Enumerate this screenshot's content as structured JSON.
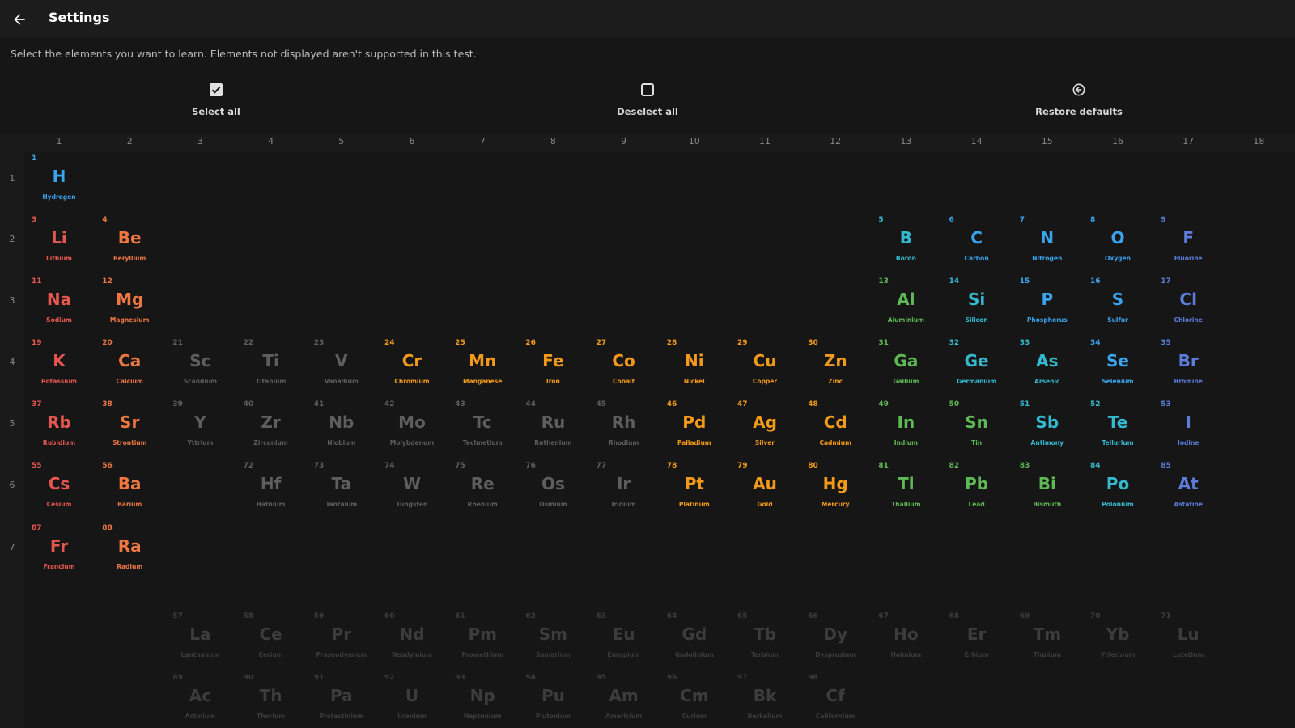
{
  "header": {
    "title": "Settings"
  },
  "description": "Select the elements you want to learn. Elements not displayed aren't supported in this test.",
  "actions": [
    {
      "label": "Select all",
      "icon": "checkbox-checked-icon"
    },
    {
      "label": "Deselect all",
      "icon": "checkbox-empty-icon"
    },
    {
      "label": "Restore defaults",
      "icon": "restore-icon"
    }
  ],
  "groups": [
    "1",
    "2",
    "3",
    "4",
    "5",
    "6",
    "7",
    "8",
    "9",
    "10",
    "11",
    "12",
    "13",
    "14",
    "15",
    "16",
    "17",
    "18"
  ],
  "periods": [
    "1",
    "2",
    "3",
    "4",
    "5",
    "6",
    "7"
  ],
  "colors": {
    "alkali": "#e8574f",
    "alkaline": "#ee7742",
    "transition": "#f39a1c",
    "post": "#5fb954",
    "metalloid": "#35b9cf",
    "nonmetal": "#3aa4ee",
    "halogen": "#5c7ddb",
    "unselected": "#5e5e5e",
    "lan": "#3c3c3c"
  },
  "elements": [
    {
      "n": "1",
      "s": "H",
      "name": "Hydrogen",
      "r": 1,
      "c": 1,
      "cat": "nonmetal"
    },
    {
      "n": "3",
      "s": "Li",
      "name": "Lithium",
      "r": 2,
      "c": 1,
      "cat": "alkali"
    },
    {
      "n": "4",
      "s": "Be",
      "name": "Beryllium",
      "r": 2,
      "c": 2,
      "cat": "alkaline"
    },
    {
      "n": "5",
      "s": "B",
      "name": "Boron",
      "r": 2,
      "c": 13,
      "cat": "metalloid"
    },
    {
      "n": "6",
      "s": "C",
      "name": "Carbon",
      "r": 2,
      "c": 14,
      "cat": "nonmetal"
    },
    {
      "n": "7",
      "s": "N",
      "name": "Nitrogen",
      "r": 2,
      "c": 15,
      "cat": "nonmetal"
    },
    {
      "n": "8",
      "s": "O",
      "name": "Oxygen",
      "r": 2,
      "c": 16,
      "cat": "nonmetal"
    },
    {
      "n": "9",
      "s": "F",
      "name": "Fluorine",
      "r": 2,
      "c": 17,
      "cat": "halogen"
    },
    {
      "n": "11",
      "s": "Na",
      "name": "Sodium",
      "r": 3,
      "c": 1,
      "cat": "alkali"
    },
    {
      "n": "12",
      "s": "Mg",
      "name": "Magnesium",
      "r": 3,
      "c": 2,
      "cat": "alkaline"
    },
    {
      "n": "13",
      "s": "Al",
      "name": "Aluminium",
      "r": 3,
      "c": 13,
      "cat": "post"
    },
    {
      "n": "14",
      "s": "Si",
      "name": "Silicon",
      "r": 3,
      "c": 14,
      "cat": "metalloid"
    },
    {
      "n": "15",
      "s": "P",
      "name": "Phosphorus",
      "r": 3,
      "c": 15,
      "cat": "nonmetal"
    },
    {
      "n": "16",
      "s": "S",
      "name": "Sulfur",
      "r": 3,
      "c": 16,
      "cat": "nonmetal"
    },
    {
      "n": "17",
      "s": "Cl",
      "name": "Chlorine",
      "r": 3,
      "c": 17,
      "cat": "halogen"
    },
    {
      "n": "19",
      "s": "K",
      "name": "Potassium",
      "r": 4,
      "c": 1,
      "cat": "alkali"
    },
    {
      "n": "20",
      "s": "Ca",
      "name": "Calcium",
      "r": 4,
      "c": 2,
      "cat": "alkaline"
    },
    {
      "n": "21",
      "s": "Sc",
      "name": "Scandium",
      "r": 4,
      "c": 3,
      "cat": "unselected"
    },
    {
      "n": "22",
      "s": "Ti",
      "name": "Titanium",
      "r": 4,
      "c": 4,
      "cat": "unselected"
    },
    {
      "n": "23",
      "s": "V",
      "name": "Vanadium",
      "r": 4,
      "c": 5,
      "cat": "unselected"
    },
    {
      "n": "24",
      "s": "Cr",
      "name": "Chromium",
      "r": 4,
      "c": 6,
      "cat": "transition"
    },
    {
      "n": "25",
      "s": "Mn",
      "name": "Manganese",
      "r": 4,
      "c": 7,
      "cat": "transition"
    },
    {
      "n": "26",
      "s": "Fe",
      "name": "Iron",
      "r": 4,
      "c": 8,
      "cat": "transition"
    },
    {
      "n": "27",
      "s": "Co",
      "name": "Cobalt",
      "r": 4,
      "c": 9,
      "cat": "transition"
    },
    {
      "n": "28",
      "s": "Ni",
      "name": "Nickel",
      "r": 4,
      "c": 10,
      "cat": "transition"
    },
    {
      "n": "29",
      "s": "Cu",
      "name": "Copper",
      "r": 4,
      "c": 11,
      "cat": "transition"
    },
    {
      "n": "30",
      "s": "Zn",
      "name": "Zinc",
      "r": 4,
      "c": 12,
      "cat": "transition"
    },
    {
      "n": "31",
      "s": "Ga",
      "name": "Gallium",
      "r": 4,
      "c": 13,
      "cat": "post"
    },
    {
      "n": "32",
      "s": "Ge",
      "name": "Germanium",
      "r": 4,
      "c": 14,
      "cat": "metalloid"
    },
    {
      "n": "33",
      "s": "As",
      "name": "Arsenic",
      "r": 4,
      "c": 15,
      "cat": "metalloid"
    },
    {
      "n": "34",
      "s": "Se",
      "name": "Selenium",
      "r": 4,
      "c": 16,
      "cat": "nonmetal"
    },
    {
      "n": "35",
      "s": "Br",
      "name": "Bromine",
      "r": 4,
      "c": 17,
      "cat": "halogen"
    },
    {
      "n": "37",
      "s": "Rb",
      "name": "Rubidium",
      "r": 5,
      "c": 1,
      "cat": "alkali"
    },
    {
      "n": "38",
      "s": "Sr",
      "name": "Strontium",
      "r": 5,
      "c": 2,
      "cat": "alkaline"
    },
    {
      "n": "39",
      "s": "Y",
      "name": "Yttrium",
      "r": 5,
      "c": 3,
      "cat": "unselected"
    },
    {
      "n": "40",
      "s": "Zr",
      "name": "Zirconium",
      "r": 5,
      "c": 4,
      "cat": "unselected"
    },
    {
      "n": "41",
      "s": "Nb",
      "name": "Niobium",
      "r": 5,
      "c": 5,
      "cat": "unselected"
    },
    {
      "n": "42",
      "s": "Mo",
      "name": "Molybdenum",
      "r": 5,
      "c": 6,
      "cat": "unselected"
    },
    {
      "n": "43",
      "s": "Tc",
      "name": "Technetium",
      "r": 5,
      "c": 7,
      "cat": "unselected"
    },
    {
      "n": "44",
      "s": "Ru",
      "name": "Ruthenium",
      "r": 5,
      "c": 8,
      "cat": "unselected"
    },
    {
      "n": "45",
      "s": "Rh",
      "name": "Rhodium",
      "r": 5,
      "c": 9,
      "cat": "unselected"
    },
    {
      "n": "46",
      "s": "Pd",
      "name": "Palladium",
      "r": 5,
      "c": 10,
      "cat": "transition"
    },
    {
      "n": "47",
      "s": "Ag",
      "name": "Silver",
      "r": 5,
      "c": 11,
      "cat": "transition"
    },
    {
      "n": "48",
      "s": "Cd",
      "name": "Cadmium",
      "r": 5,
      "c": 12,
      "cat": "transition"
    },
    {
      "n": "49",
      "s": "In",
      "name": "Indium",
      "r": 5,
      "c": 13,
      "cat": "post"
    },
    {
      "n": "50",
      "s": "Sn",
      "name": "Tin",
      "r": 5,
      "c": 14,
      "cat": "post"
    },
    {
      "n": "51",
      "s": "Sb",
      "name": "Antimony",
      "r": 5,
      "c": 15,
      "cat": "metalloid"
    },
    {
      "n": "52",
      "s": "Te",
      "name": "Tellurium",
      "r": 5,
      "c": 16,
      "cat": "metalloid"
    },
    {
      "n": "53",
      "s": "I",
      "name": "Iodine",
      "r": 5,
      "c": 17,
      "cat": "halogen"
    },
    {
      "n": "55",
      "s": "Cs",
      "name": "Cesium",
      "r": 6,
      "c": 1,
      "cat": "alkali"
    },
    {
      "n": "56",
      "s": "Ba",
      "name": "Barium",
      "r": 6,
      "c": 2,
      "cat": "alkaline"
    },
    {
      "n": "72",
      "s": "Hf",
      "name": "Hafnium",
      "r": 6,
      "c": 4,
      "cat": "unselected"
    },
    {
      "n": "73",
      "s": "Ta",
      "name": "Tantalum",
      "r": 6,
      "c": 5,
      "cat": "unselected"
    },
    {
      "n": "74",
      "s": "W",
      "name": "Tungsten",
      "r": 6,
      "c": 6,
      "cat": "unselected"
    },
    {
      "n": "75",
      "s": "Re",
      "name": "Rhenium",
      "r": 6,
      "c": 7,
      "cat": "unselected"
    },
    {
      "n": "76",
      "s": "Os",
      "name": "Osmium",
      "r": 6,
      "c": 8,
      "cat": "unselected"
    },
    {
      "n": "77",
      "s": "Ir",
      "name": "Iridium",
      "r": 6,
      "c": 9,
      "cat": "unselected"
    },
    {
      "n": "78",
      "s": "Pt",
      "name": "Platinum",
      "r": 6,
      "c": 10,
      "cat": "transition"
    },
    {
      "n": "79",
      "s": "Au",
      "name": "Gold",
      "r": 6,
      "c": 11,
      "cat": "transition"
    },
    {
      "n": "80",
      "s": "Hg",
      "name": "Mercury",
      "r": 6,
      "c": 12,
      "cat": "transition"
    },
    {
      "n": "81",
      "s": "Tl",
      "name": "Thallium",
      "r": 6,
      "c": 13,
      "cat": "post"
    },
    {
      "n": "82",
      "s": "Pb",
      "name": "Lead",
      "r": 6,
      "c": 14,
      "cat": "post"
    },
    {
      "n": "83",
      "s": "Bi",
      "name": "Bismuth",
      "r": 6,
      "c": 15,
      "cat": "post"
    },
    {
      "n": "84",
      "s": "Po",
      "name": "Polonium",
      "r": 6,
      "c": 16,
      "cat": "metalloid"
    },
    {
      "n": "85",
      "s": "At",
      "name": "Astatine",
      "r": 6,
      "c": 17,
      "cat": "halogen"
    },
    {
      "n": "87",
      "s": "Fr",
      "name": "Francium",
      "r": 7,
      "c": 1,
      "cat": "alkali"
    },
    {
      "n": "88",
      "s": "Ra",
      "name": "Radium",
      "r": 7,
      "c": 2,
      "cat": "alkaline"
    },
    {
      "n": "57",
      "s": "La",
      "name": "Lanthanum",
      "r": 9,
      "c": 3,
      "cat": "lan"
    },
    {
      "n": "58",
      "s": "Ce",
      "name": "Cerium",
      "r": 9,
      "c": 4,
      "cat": "lan"
    },
    {
      "n": "59",
      "s": "Pr",
      "name": "Praseodymium",
      "r": 9,
      "c": 5,
      "cat": "lan"
    },
    {
      "n": "60",
      "s": "Nd",
      "name": "Neodymium",
      "r": 9,
      "c": 6,
      "cat": "lan"
    },
    {
      "n": "61",
      "s": "Pm",
      "name": "Promethium",
      "r": 9,
      "c": 7,
      "cat": "lan"
    },
    {
      "n": "62",
      "s": "Sm",
      "name": "Samarium",
      "r": 9,
      "c": 8,
      "cat": "lan"
    },
    {
      "n": "63",
      "s": "Eu",
      "name": "Europium",
      "r": 9,
      "c": 9,
      "cat": "lan"
    },
    {
      "n": "64",
      "s": "Gd",
      "name": "Gadolinium",
      "r": 9,
      "c": 10,
      "cat": "lan"
    },
    {
      "n": "65",
      "s": "Tb",
      "name": "Terbium",
      "r": 9,
      "c": 11,
      "cat": "lan"
    },
    {
      "n": "66",
      "s": "Dy",
      "name": "Dysprosium",
      "r": 9,
      "c": 12,
      "cat": "lan"
    },
    {
      "n": "67",
      "s": "Ho",
      "name": "Holmium",
      "r": 9,
      "c": 13,
      "cat": "lan"
    },
    {
      "n": "68",
      "s": "Er",
      "name": "Erbium",
      "r": 9,
      "c": 14,
      "cat": "lan"
    },
    {
      "n": "69",
      "s": "Tm",
      "name": "Thulium",
      "r": 9,
      "c": 15,
      "cat": "lan"
    },
    {
      "n": "70",
      "s": "Yb",
      "name": "Ytterbium",
      "r": 9,
      "c": 16,
      "cat": "lan"
    },
    {
      "n": "71",
      "s": "Lu",
      "name": "Lutetium",
      "r": 9,
      "c": 17,
      "cat": "lan"
    },
    {
      "n": "89",
      "s": "Ac",
      "name": "Actinium",
      "r": 10,
      "c": 3,
      "cat": "lan"
    },
    {
      "n": "90",
      "s": "Th",
      "name": "Thorium",
      "r": 10,
      "c": 4,
      "cat": "lan"
    },
    {
      "n": "91",
      "s": "Pa",
      "name": "Protactinium",
      "r": 10,
      "c": 5,
      "cat": "lan"
    },
    {
      "n": "92",
      "s": "U",
      "name": "Uranium",
      "r": 10,
      "c": 6,
      "cat": "lan"
    },
    {
      "n": "93",
      "s": "Np",
      "name": "Neptunium",
      "r": 10,
      "c": 7,
      "cat": "lan"
    },
    {
      "n": "94",
      "s": "Pu",
      "name": "Plutonium",
      "r": 10,
      "c": 8,
      "cat": "lan"
    },
    {
      "n": "95",
      "s": "Am",
      "name": "Americium",
      "r": 10,
      "c": 9,
      "cat": "lan"
    },
    {
      "n": "96",
      "s": "Cm",
      "name": "Curium",
      "r": 10,
      "c": 10,
      "cat": "lan"
    },
    {
      "n": "97",
      "s": "Bk",
      "name": "Berkelium",
      "r": 10,
      "c": 11,
      "cat": "lan"
    },
    {
      "n": "98",
      "s": "Cf",
      "name": "Californium",
      "r": 10,
      "c": 12,
      "cat": "lan"
    }
  ]
}
